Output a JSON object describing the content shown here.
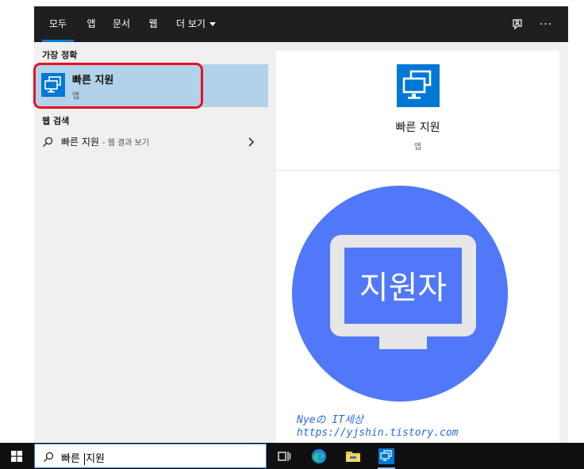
{
  "tabs": [
    {
      "label": "모두",
      "active": true
    },
    {
      "label": "앱",
      "active": false
    },
    {
      "label": "문서",
      "active": false
    },
    {
      "label": "웹",
      "active": false
    },
    {
      "label": "더 보기",
      "active": false
    }
  ],
  "top_icons": [
    "feedback-icon",
    "more-options-icon"
  ],
  "top_more_label": "···",
  "best_match": {
    "section_label": "가장 정확",
    "title": "빠른 지원",
    "subtitle": "앱",
    "icon": "quick-assist-icon"
  },
  "web_search": {
    "section_label": "웹 검색",
    "query": "빠른 지원",
    "hint": "- 웹 결과 보기"
  },
  "detail": {
    "title": "빠른 지원",
    "subtitle": "앱",
    "hero_text": "지원자"
  },
  "watermark": {
    "line1": "Nyeの IT세상",
    "line2": "https://yjshin.tistory.com"
  },
  "taskbar": {
    "search_value_before": "빠른 ",
    "search_value_after": "지원",
    "icons": [
      "windows-start-icon",
      "task-view-icon",
      "edge-icon",
      "file-explorer-icon",
      "quick-assist-icon"
    ]
  },
  "colors": {
    "accent": "#0078d4",
    "selected_bg": "#b2d2ea",
    "highlight_border": "#e81123",
    "hero_circle": "#5078f8"
  }
}
